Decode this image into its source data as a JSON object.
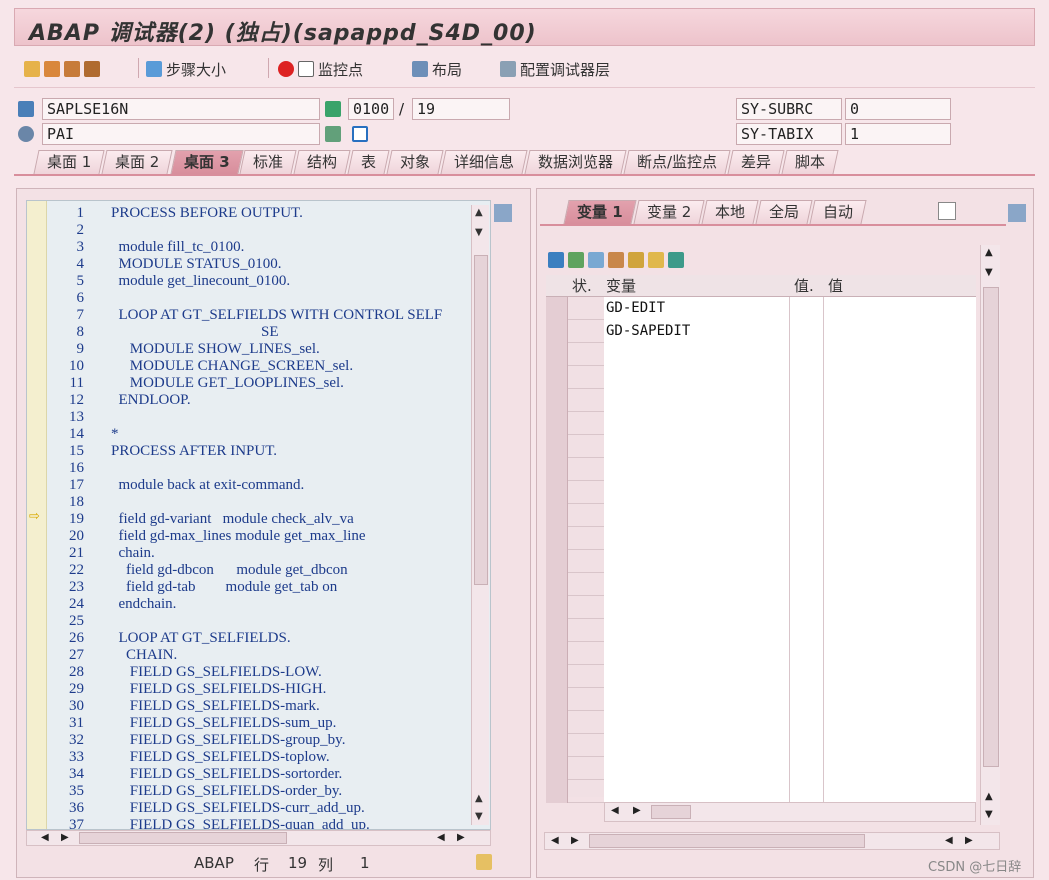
{
  "title": "ABAP 调试器(2)  (独占)(sapappd_S4D_00)",
  "toolbar": {
    "step_size": "步骤大小",
    "watchpoint": "监控点",
    "layout": "布局",
    "configure": "配置调试器层"
  },
  "info": {
    "program": "SAPLSE16N",
    "event": "PAI",
    "screen_no": "0100",
    "slash": "/",
    "line_no": "19",
    "sy_subrc_label": "SY-SUBRC",
    "sy_subrc_value": "0",
    "sy_tabix_label": "SY-TABIX",
    "sy_tabix_value": "1"
  },
  "main_tabs": [
    "桌面 1",
    "桌面 2",
    "桌面 3",
    "标准",
    "结构",
    "表",
    "对象",
    "详细信息",
    "数据浏览器",
    "断点/监控点",
    "差异",
    "脚本"
  ],
  "var_tabs": [
    "变量 1",
    "变量 2",
    "本地",
    "全局",
    "自动"
  ],
  "code_lines": [
    {
      "n": "1",
      "t": "PROCESS BEFORE OUTPUT."
    },
    {
      "n": "2",
      "t": ""
    },
    {
      "n": "3",
      "t": "  module fill_tc_0100."
    },
    {
      "n": "4",
      "t": "  MODULE STATUS_0100."
    },
    {
      "n": "5",
      "t": "  module get_linecount_0100."
    },
    {
      "n": "6",
      "t": ""
    },
    {
      "n": "7",
      "t": "  LOOP AT GT_SELFIELDS WITH CONTROL SELF"
    },
    {
      "n": "8",
      "t": "                                        SE"
    },
    {
      "n": "9",
      "t": "     MODULE SHOW_LINES_sel."
    },
    {
      "n": "10",
      "t": "     MODULE CHANGE_SCREEN_sel."
    },
    {
      "n": "11",
      "t": "     MODULE GET_LOOPLINES_sel."
    },
    {
      "n": "12",
      "t": "  ENDLOOP."
    },
    {
      "n": "13",
      "t": ""
    },
    {
      "n": "14",
      "t": "*"
    },
    {
      "n": "15",
      "t": "PROCESS AFTER INPUT."
    },
    {
      "n": "16",
      "t": ""
    },
    {
      "n": "17",
      "t": "  module back at exit-command."
    },
    {
      "n": "18",
      "t": ""
    },
    {
      "n": "19",
      "t": "  field gd-variant   module check_alv_va"
    },
    {
      "n": "20",
      "t": "  field gd-max_lines module get_max_line"
    },
    {
      "n": "21",
      "t": "  chain."
    },
    {
      "n": "22",
      "t": "    field gd-dbcon      module get_dbcon"
    },
    {
      "n": "23",
      "t": "    field gd-tab        module get_tab on"
    },
    {
      "n": "24",
      "t": "  endchain."
    },
    {
      "n": "25",
      "t": ""
    },
    {
      "n": "26",
      "t": "  LOOP AT GT_SELFIELDS."
    },
    {
      "n": "27",
      "t": "    CHAIN."
    },
    {
      "n": "28",
      "t": "     FIELD GS_SELFIELDS-LOW."
    },
    {
      "n": "29",
      "t": "     FIELD GS_SELFIELDS-HIGH."
    },
    {
      "n": "30",
      "t": "     FIELD GS_SELFIELDS-mark."
    },
    {
      "n": "31",
      "t": "     FIELD GS_SELFIELDS-sum_up."
    },
    {
      "n": "32",
      "t": "     FIELD GS_SELFIELDS-group_by."
    },
    {
      "n": "33",
      "t": "     FIELD GS_SELFIELDS-toplow."
    },
    {
      "n": "34",
      "t": "     FIELD GS_SELFIELDS-sortorder."
    },
    {
      "n": "35",
      "t": "     FIELD GS_SELFIELDS-order_by."
    },
    {
      "n": "36",
      "t": "     FIELD GS_SELFIELDS-curr_add_up."
    },
    {
      "n": "37",
      "t": "     FIELD GS_SELFIELDS-quan_add_up."
    }
  ],
  "var_table": {
    "col_status": "状.",
    "col_variable": "变量",
    "col_val_short": "值.",
    "col_value": "值",
    "rows": [
      "GD-EDIT",
      "GD-SAPEDIT",
      "",
      "",
      "",
      "",
      "",
      "",
      "",
      "",
      "",
      "",
      "",
      "",
      "",
      "",
      "",
      "",
      "",
      "",
      "",
      ""
    ]
  },
  "statusbar": {
    "lang": "ABAP",
    "line_label": "行",
    "line_value": "19",
    "col_label": "列",
    "col_value": "1"
  },
  "watermark": "CSDN @七日辞",
  "colors": {
    "accent": "#d88e9c",
    "code_bg": "#e8eef2",
    "gutter": "#f4efcf"
  }
}
